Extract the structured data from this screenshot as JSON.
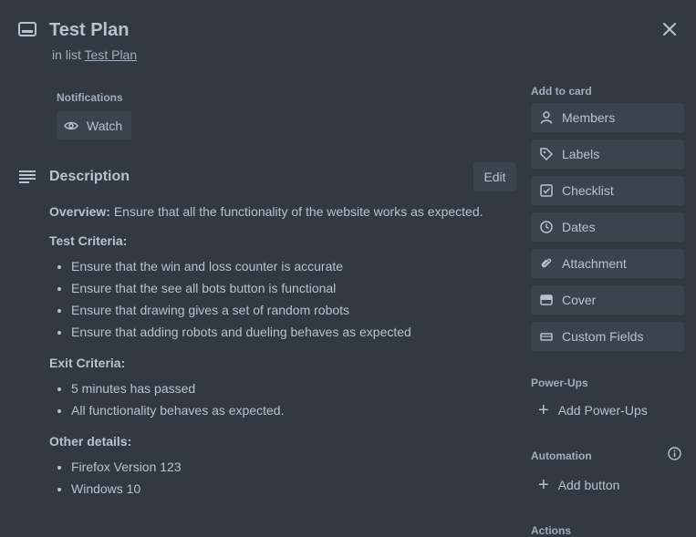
{
  "header": {
    "title": "Test Plan",
    "in_list_prefix": "in list",
    "list_name": "Test Plan"
  },
  "notifications": {
    "label": "Notifications",
    "watch_label": "Watch"
  },
  "description": {
    "title": "Description",
    "edit_label": "Edit",
    "overview_label": "Overview:",
    "overview_text": "Ensure that all the functionality of the website works as expected.",
    "test_criteria_heading": "Test Criteria:",
    "test_criteria": [
      "Ensure that the win and loss counter is accurate",
      "Ensure that the see all bots button is functional",
      "Ensure that drawing gives a set of random robots",
      "Ensure that adding robots and dueling behaves as expected"
    ],
    "exit_criteria_heading": "Exit Criteria:",
    "exit_criteria": [
      "5 minutes has passed",
      "All functionality behaves as expected."
    ],
    "other_heading": "Other details:",
    "other_details": [
      "Firefox Version 123",
      "Windows 10"
    ]
  },
  "sidebar": {
    "add_to_card_label": "Add to card",
    "buttons": [
      {
        "label": "Members",
        "icon": "person-icon"
      },
      {
        "label": "Labels",
        "icon": "tag-icon"
      },
      {
        "label": "Checklist",
        "icon": "checkbox-icon"
      },
      {
        "label": "Dates",
        "icon": "clock-icon"
      },
      {
        "label": "Attachment",
        "icon": "paperclip-icon"
      },
      {
        "label": "Cover",
        "icon": "cover-icon"
      },
      {
        "label": "Custom Fields",
        "icon": "custom-fields-icon"
      }
    ],
    "powerups_label": "Power-Ups",
    "add_powerups_label": "Add Power-Ups",
    "automation_label": "Automation",
    "add_button_label": "Add button",
    "actions_label": "Actions"
  }
}
